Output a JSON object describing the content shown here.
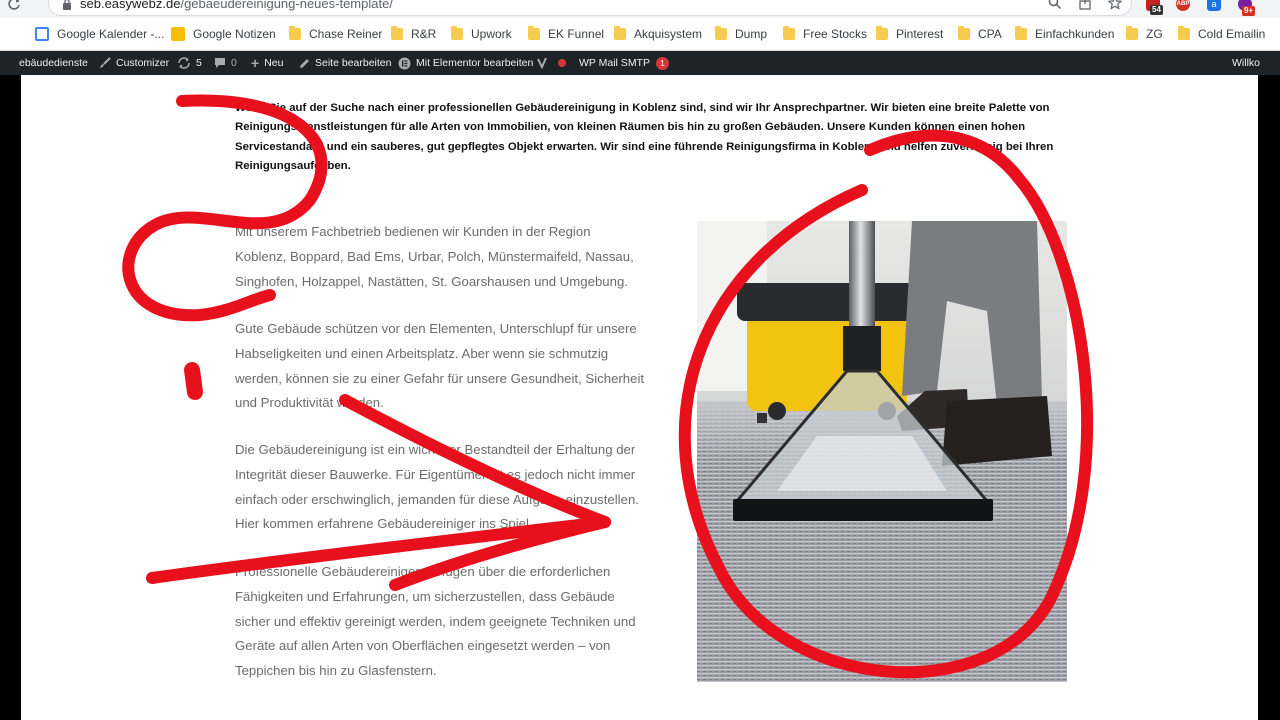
{
  "browser": {
    "url_domain": "seb.easywebz.de",
    "url_path": "/gebaeudereinigung-neues-template/",
    "extensions": [
      {
        "name": "mail-ext-icon",
        "badge": "54",
        "color": "#c5221f"
      },
      {
        "name": "adblock-icon",
        "label": "ABP",
        "color": "#d93025"
      },
      {
        "name": "translate-ext-icon",
        "label": "a",
        "color": "#1a73e8"
      },
      {
        "name": "extension-icon",
        "badge": "9+",
        "color": "#7b1fa2"
      }
    ]
  },
  "bookmarks": [
    {
      "label": "Google Kalender -...",
      "icon": "google-calendar-icon"
    },
    {
      "label": "Google Notizen",
      "icon": "google-keep-icon"
    },
    {
      "label": "Chase Reiner",
      "icon": "folder-icon"
    },
    {
      "label": "R&R",
      "icon": "folder-icon"
    },
    {
      "label": "Upwork",
      "icon": "folder-icon"
    },
    {
      "label": "EK Funnel",
      "icon": "folder-icon"
    },
    {
      "label": "Akquisystem",
      "icon": "folder-icon"
    },
    {
      "label": "Dump",
      "icon": "folder-icon"
    },
    {
      "label": "Free Stocks",
      "icon": "folder-icon"
    },
    {
      "label": "Pinterest",
      "icon": "folder-icon"
    },
    {
      "label": "CPA",
      "icon": "folder-icon"
    },
    {
      "label": "Einfachkunden",
      "icon": "folder-icon"
    },
    {
      "label": "ZG",
      "icon": "folder-icon"
    },
    {
      "label": "Cold Emailin",
      "icon": "folder-icon"
    }
  ],
  "adminbar": {
    "site_name": "ebäudedienste",
    "customizer": "Customizer",
    "updates_count": "5",
    "comments_count": "0",
    "new_label": "Neu",
    "edit_page": "Seite bearbeiten",
    "elementor": "Mit Elementor bearbeiten",
    "smtp": "WP Mail SMTP",
    "smtp_badge": "1",
    "greeting": "Willko"
  },
  "content": {
    "intro": "Wenn Sie auf der Suche nach einer professionellen Gebäudereinigung in Koblenz sind, sind wir Ihr Ansprechpartner. Wir bieten eine breite Palette von Reinigungsdienstleistungen für alle Arten von Immobilien, von kleinen Räumen bis hin zu großen Gebäuden. Unsere Kunden können einen hohen Servicestandard und ein sauberes, gut gepflegtes Objekt erwarten. Wir sind eine führende Reinigungsfirma in Koblenz und helfen zuverlässig bei Ihren Reinigungsaufgaben.",
    "paragraphs": [
      "Mit unserem Fachbetrieb bedienen wir Kunden in der Region Koblenz, Boppard, Bad Ems, Urbar, Polch, Münstermaifeld, Nassau, Singhofen, Holzappel, Nastätten, St. Goarshausen und Umgebung.",
      "Gute Gebäude schützen vor den Elementen, Unterschlupf für unsere Habseligkeiten und einen Arbeitsplatz. Aber wenn sie schmutzig werden, können sie zu einer Gefahr für unsere Gesundheit, Sicherheit und Produktivität werden.",
      "Die Gebäudereinigung ist ein wichtiger Bestandteil der Erhaltung der Integrität dieser Bauwerke. Für Eigentümer ist es jedoch nicht immer einfach oder erschwinglich, jemanden für diese Aufgabe einzustellen. Hier kommen erfahrene Gebäudereiniger ins Spiel.",
      "Professionelle Gebäudereiniger verfügen über die erforderlichen Fähigkeiten und Erfahrungen, um sicherzustellen, dass Gebäude sicher und effektiv gereinigt werden, indem geeignete Techniken und Geräte auf allen Arten von Oberflächen eingesetzt werden – von Teppichen bis hin zu Glasfenstern."
    ]
  },
  "colors": {
    "annotation": "#e8101c",
    "adminbar": "#1d2327",
    "paragraph_text": "#6b6b6b"
  }
}
